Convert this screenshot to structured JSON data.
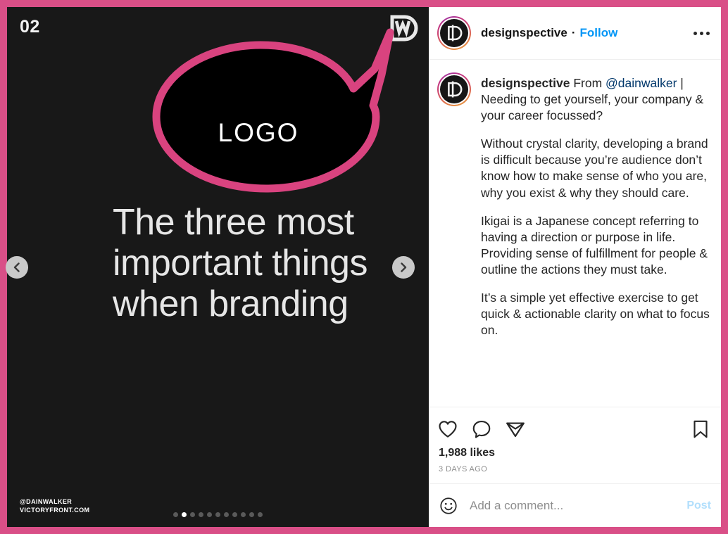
{
  "theme": {
    "page_border_color": "#d94f87",
    "accent_blue": "#0095f6",
    "bubble_pink": "#d9437f",
    "media_bg": "#181818"
  },
  "media": {
    "slide_number": "02",
    "brand_mark_icon": "dw-monogram-icon",
    "bubble_label": "LOGO",
    "headline_lines": [
      "The three most",
      "important things",
      "when branding"
    ],
    "watermark_lines": [
      "@DAINWALKER",
      "VICTORYFRONT.COM"
    ],
    "carousel": {
      "total": 11,
      "active_index": 1,
      "prev_label": "Previous",
      "next_label": "Next"
    }
  },
  "post": {
    "header": {
      "username": "designspective",
      "separator": "·",
      "follow_label": "Follow",
      "more_options_label": "More options",
      "avatar_icon": "designspective-avatar"
    },
    "caption": {
      "username": "designspective",
      "intro_prefix": "From ",
      "mention": "@dainwalker",
      "intro_suffix": " | Needing to get yourself, your company & your career focussed?",
      "paragraphs": [
        "Without crystal clarity, developing a brand is difficult because you’re audience don’t know how to make sense of who you are, why you exist & why they should care.",
        "Ikigai is a Japanese concept referring to having a direction or purpose in life. Providing sense of fulfillment for people & outline the actions they must take.",
        "It’s a simple yet effective exercise to get quick & actionable clarity on what to focus on."
      ]
    },
    "actions": {
      "like_label": "Like",
      "comment_label": "Comment",
      "share_label": "Share",
      "save_label": "Save"
    },
    "likes_text": "1,988 likes",
    "timestamp": "3 DAYS AGO",
    "comment_box": {
      "emoji_label": "Emoji",
      "placeholder": "Add a comment...",
      "value": "",
      "post_label": "Post"
    }
  }
}
